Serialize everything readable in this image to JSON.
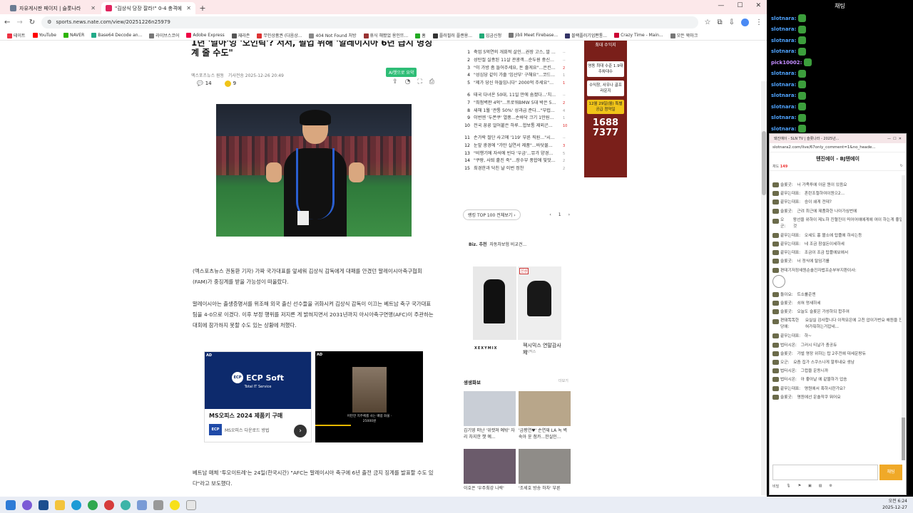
{
  "browser": {
    "tabs": [
      {
        "label": "자유게시판 페이지 | 슬롯나라",
        "color": "#6b7c93"
      },
      {
        "label": "\"김상식 당장 잘라!\" 0-4 충격에",
        "color": "#e0245e"
      }
    ],
    "url": "sports.news.nate.com/view/20251226n25979",
    "bookmarks": [
      "테이트",
      "YouTube",
      "NAVER",
      "Base64 Decode an...",
      "라이브스코어",
      "Adobe Express",
      "재라존",
      "무인상품권 (다음상...",
      "404 Not Found 처방",
      "휴식 해봤었 용인뜨...",
      "홈",
      "플러필러 플랜용...",
      "입금신청",
      "Jibli Meet Firebase...",
      "블랙플러기업편통...",
      "Crazy Time - Main...",
      "모든 북마크"
    ]
  },
  "article": {
    "headline": "1년 '날아'잉 '오인릭'? 서서, 필업 위해 '알레이시아 6년 급시 명징계 줄 수도\"",
    "source": "엑스포츠뉴스 원동",
    "date": "기사전송 2025-12-26 20:49",
    "comments": "14",
    "likes": "9",
    "summary_btn": "AI챗으로 요약",
    "para1": "(엑스포츠뉴스 권동환 기자) 가짜 국가대표를 앞세워 김상식 감독에게 대패를 안겼던 말레이시아축구협회(FAM)가 중징계를 받을 가능성이 떠올랐다.",
    "para2": "말레이시아는 출생증명서를 위조해 외국 출신 선수들을 귀화시켜 김상식 감독이 이끄는 베트남 축구 국가대표팀을 4-0으로 이겼다. 이후 부정 행위를 저지른 게 밝혀지면서 2031년까지 아시아축구연맹(AFC)이 주관하는 대회에 참가하지 못할 수도 있는 상황에 처했다.",
    "para3": "베트남 매체 '투오이트레'는 24일(한국시간) \"AFC는 말레이시아 축구에 6년 출전 금지 징계를 발표할 수도 있다\"라고 보도했다."
  },
  "ads": {
    "ad_label": "AD",
    "ecp_title": "ECP Soft",
    "ecp_sub": "Total IT Service",
    "ecp_product": "MS오피스 2024 제품키 구매",
    "ecp_desc": "MS오피스 다운로드 방법",
    "ecp_badge": "ECP",
    "ad2_caption": "어떤한 지주체를 사는 배럼 화물 · 25000원"
  },
  "ranking": [
    {
      "n": "1",
      "t": "축업 5억연의 개회적 살인...권장 고스, 말 ...",
      "c": "--",
      "red": false
    },
    {
      "n": "2",
      "t": "성탄절 실종된 11살 관광객...순두원 중신...",
      "c": "--",
      "red": false
    },
    {
      "n": "3",
      "t": "\"이 가방 좀 들어주세요, 돈 줄게요\"...은킨...",
      "c": "2",
      "red": true
    },
    {
      "n": "4",
      "t": "\"성심당 같이 가줄 '임산부' 구해요\"...코드...",
      "c": "1",
      "red": false
    },
    {
      "n": "5",
      "t": "\"제가 당신 아들입니다\" 2000억 주세요\"...",
      "c": "1",
      "red": true
    },
    {
      "n": "6",
      "t": "태국 다녀온 50대, 11일 만에 숨졌다...'치...",
      "c": "--",
      "red": false
    },
    {
      "n": "7",
      "t": "\"최첨벽판 4억\"...프로워BMW 5대 박은 5...",
      "c": "2",
      "red": true
    },
    {
      "n": "8",
      "t": "새해 1월 '관통 50%' 성과급 준다...\"부럽...",
      "c": "4",
      "red": false
    },
    {
      "n": "9",
      "t": "이번엔 '두쫀쿠' 열풍...손바닥 크기 1만원...",
      "c": "1",
      "red": false
    },
    {
      "n": "10",
      "t": "전국 꿍꿍 얼어붙은 하루...합보통 제외곤...",
      "c": "10",
      "red": true
    },
    {
      "n": "11",
      "t": "손가락 절단 사고에 '119' 부른 직원...\"시...",
      "c": "--",
      "red": false
    },
    {
      "n": "12",
      "t": "눈앞 광경에 \"가만 실연서 제품\"...바닷물...",
      "c": "3",
      "red": true
    },
    {
      "n": "13",
      "t": "\"비행기에 자석에 빈다 '우금'...뮤가 양경...",
      "c": "5",
      "red": false
    },
    {
      "n": "14",
      "t": "\"쿠팡, 사퇴 흩진 죽\"...장수부 풍합에 빛맛...",
      "c": "2",
      "red": false
    },
    {
      "n": "15",
      "t": "최경한과 닥친 날 이번 정찬",
      "c": "2",
      "red": false
    }
  ],
  "side": {
    "more_btn": "랭킹 TOP 100 전체보기",
    "page": "1",
    "biz_label": "Biz. 추천",
    "biz_text": "자동차보험 비교견...",
    "product_name": "젝시믹스 연말감사제",
    "product_brand": "XEXYMIX",
    "product_sub": "젝시믹스",
    "product_tag": "신상",
    "photo_section": "생생화보",
    "photo_more": "더보기",
    "photos": [
      {
        "cap": "김기영 떠난 '위캣쳐 예밖' 자리 차지한 챗 예...",
        "color": "#c9ced6"
      },
      {
        "cap": "'금평연♥' 손연재 LA 녹 벽숙아 윤 첨카...한실인...",
        "color": "#b8a68a"
      },
      {
        "cap": "이호은 '우주최강 나락'",
        "color": "#6b5b6b"
      },
      {
        "cap": "'조세호 방송 하차' 부른",
        "color": "#8f8c88"
      }
    ]
  },
  "banner": {
    "top": "최대 수익지",
    "b1": "영동 최대 수준 1.9대 주차대수",
    "b2": "수익창, 사우나 골프라운지",
    "b3": "12월 29일(월) 특별공급 청약일",
    "phone1": "1688",
    "phone2": "7377"
  },
  "chat": {
    "title": "채팅",
    "lines": [
      {
        "nick": "slotnara:",
        "text": ""
      },
      {
        "nick": "slotnara:",
        "text": ""
      },
      {
        "nick": "slotnara:",
        "text": ""
      },
      {
        "nick": "slotnara:",
        "text": ""
      },
      {
        "nick": "pick10002:",
        "text": ""
      },
      {
        "nick": "slotnara:",
        "text": ""
      },
      {
        "nick": "slotnara:",
        "text": ""
      },
      {
        "nick": "slotnara:",
        "text": ""
      },
      {
        "nick": "slotnara:",
        "text": ""
      },
      {
        "nick": "slotnara:",
        "text": ""
      },
      {
        "nick": "slotnara:",
        "text": ""
      }
    ]
  },
  "popup": {
    "window_title": "돼진예이 - SLN TV | 슬롯나라 - 2025년...",
    "url": "slotnara2.com/live/67only_comment=1&no_heade...",
    "stream_title": "텐진에이 - BJ텐에이",
    "viewers_label": "채도",
    "viewers": "149",
    "messages": [
      {
        "nick": "슬롯굿:",
        "text": "너 가족투에 아문 뭔이 있음요"
      },
      {
        "nick": "끝무는대표:",
        "text": "혼란조절하여이원으2..."
      },
      {
        "nick": "끝무는대표:",
        "text": "승이 쇄게 전데?"
      },
      {
        "nick": "슬롯굿:",
        "text": "근려 최근에 제품화한 나아가심번에"
      },
      {
        "nick": "오군:",
        "text": "왕선을 위하이 제노하 진혈진이 띄어어예에게에 여이 하는게 좋일것"
      },
      {
        "nick": "끝무는대표:",
        "text": "오세도 흉 볼소에 탑플에 하사는등"
      },
      {
        "nick": "끝무는대표:",
        "text": "네 조금 참설돈이세하세"
      },
      {
        "nick": "끝무는대표:",
        "text": "조금이 조금 탑플에보에서"
      },
      {
        "nick": "슬롯굿:",
        "text": "너 정식에 탈임기를"
      },
      {
        "nick": "편데기저정새원순솔진자법프순부부지환이사:",
        "text": ""
      },
      {
        "nick": "",
        "text": ""
      },
      {
        "nick": "돌이요:",
        "text": "트소롤준엔"
      },
      {
        "nick": "슬롯굿:",
        "text": "쇠혀 멍새하세"
      },
      {
        "nick": "슬롯굿:",
        "text": "오늘도 슬롯은 가성하되 합주여"
      },
      {
        "nick": "편돼똑똑한당에:",
        "text": "요실실 감사합니다 이적묘은에 고친 압이가번요 해원을 진혀가줘하는거잡네..."
      },
      {
        "nick": "끝무는대표:",
        "text": "하~"
      },
      {
        "nick": "법터시온:",
        "text": "그러시 티날가 충공듀"
      },
      {
        "nick": "슬롯굿:",
        "text": "가벌 명장 위하는 탑 2주전에 대세운팡듀"
      },
      {
        "nick": "오군:",
        "text": "요즘 집가 스쿠스나게 말투내요 생남"
      },
      {
        "nick": "법터시온:",
        "text": "그럽을 운동니까"
      },
      {
        "nick": "법터시온:",
        "text": "아 좋아날 에 같물하가 업송"
      },
      {
        "nick": "끝무는대표:",
        "text": "명원에서 혹하시란가요?"
      },
      {
        "nick": "슬롯굿:",
        "text": "명원에선 운솔작쿠 뭐어요"
      }
    ],
    "send": "채팅",
    "footer": [
      "비밀",
      "",
      "",
      "",
      "",
      ""
    ]
  },
  "taskbar": {
    "time": "오전 6:24",
    "date": "2025-12-27"
  }
}
